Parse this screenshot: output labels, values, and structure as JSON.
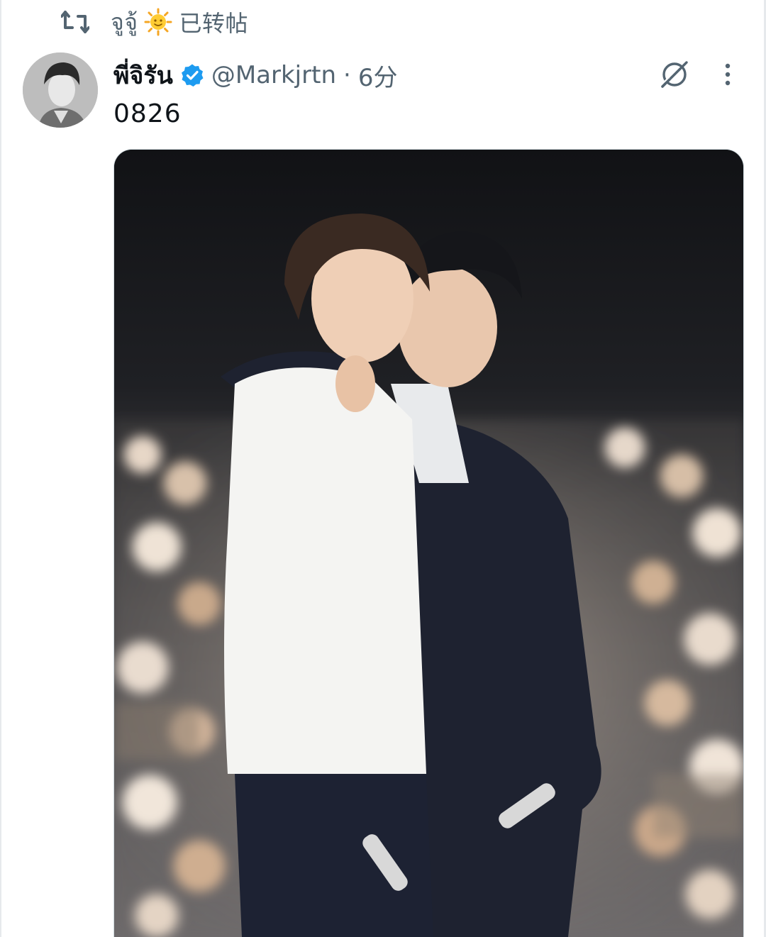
{
  "repost": {
    "icon": "repost-icon",
    "reposter_name": "จูจู้",
    "reposter_emoji": "sun-with-face",
    "reposted_label": "已转帖"
  },
  "tweet": {
    "avatar_icon": "user-avatar",
    "display_name": "พี่จิรัน",
    "verified_icon": "verified-badge-icon",
    "handle": "@Markjrtn",
    "separator": "·",
    "time": "6分",
    "grok_icon": "grok-icon",
    "more_icon": "more-vertical-icon",
    "text": "0826",
    "media_icon": "photo"
  },
  "colors": {
    "accent_blue": "#1d9bf0",
    "secondary_text": "#536471",
    "primary_text": "#0f1419",
    "border": "#cfd9de"
  }
}
